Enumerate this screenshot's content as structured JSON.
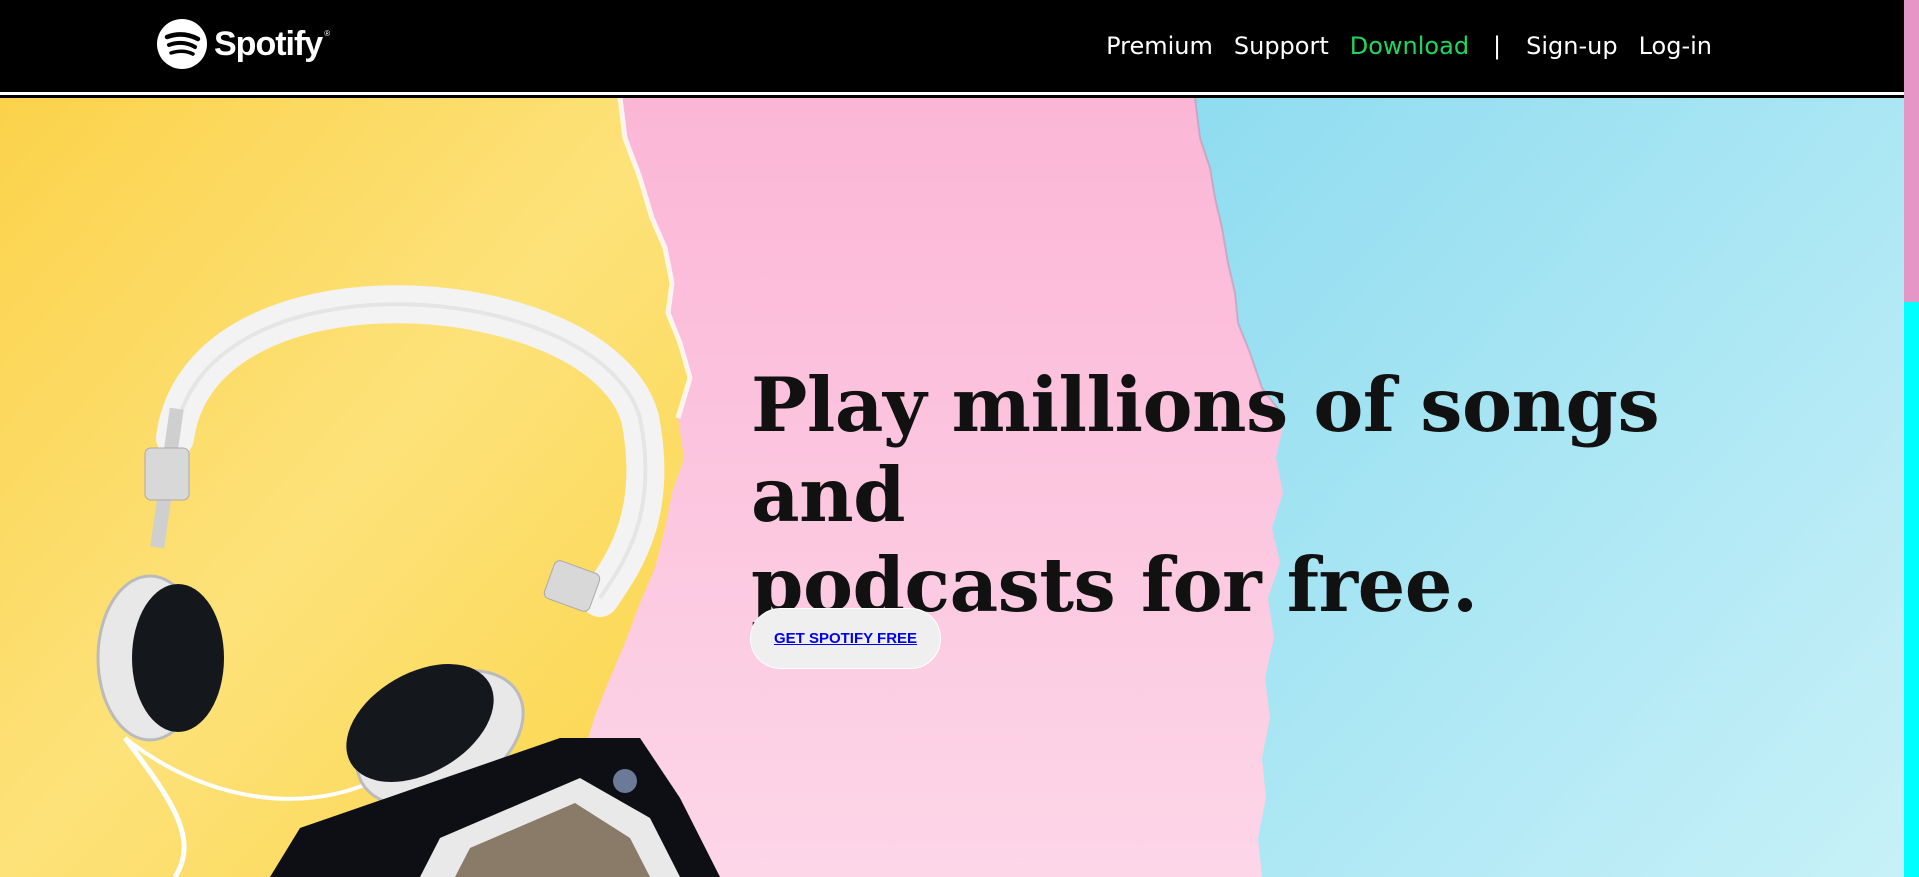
{
  "header": {
    "logo_text": "Spotify",
    "logo_reg": "®",
    "nav": {
      "premium": "Premium",
      "support": "Support",
      "download": "Download",
      "separator": "|",
      "signup": "Sign-up",
      "login": "Log-in"
    }
  },
  "hero": {
    "headline_line1": "Play millions of songs and",
    "headline_line2": "podcasts for free.",
    "cta_label": "GET SPOTIFY FREE"
  },
  "colors": {
    "header_bg": "#000000",
    "nav_active": "#1ed760",
    "link_blue": "#0000ee",
    "bg_yellow": "#fcd94f",
    "bg_pink": "#fbc6df",
    "bg_blue": "#b3eaf5",
    "scrollbar_track": "#00ffff",
    "scrollbar_thumb": "#e696c6"
  },
  "icons": [
    "spotify-logo-icon",
    "headphones-image",
    "phone-armband-image"
  ]
}
